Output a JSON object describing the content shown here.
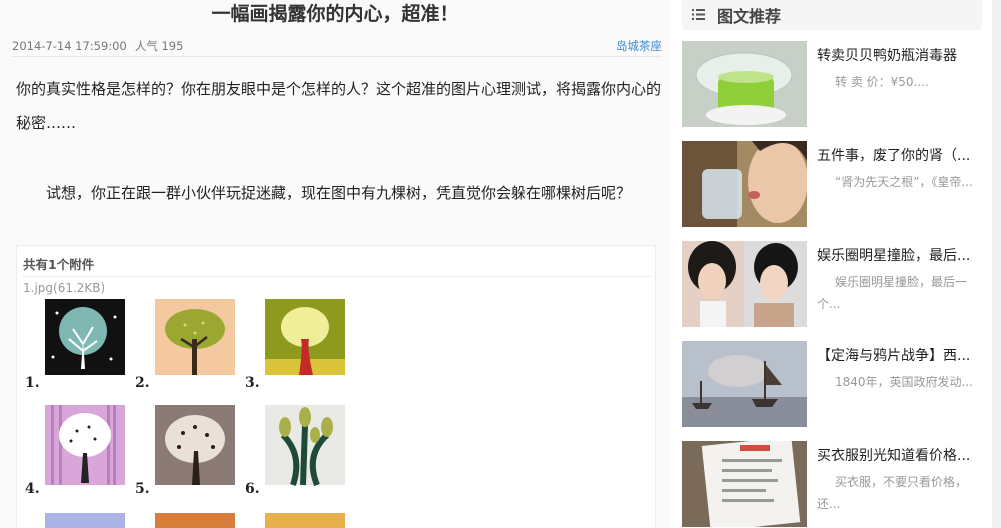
{
  "article": {
    "title": "一幅画揭露你的内心，超准！",
    "date": "2014-7-14 17:59:00",
    "views": "人气 195",
    "source": "岛城茶座",
    "paragraph1": "你的真实性格是怎样的？你在朋友眼中是个怎样的人？这个超准的图片心理测试，将揭露你内心的秘密……",
    "paragraph2": "试想，你正在跟一群小伙伴玩捉迷藏，现在图中有九棵树，凭直觉你会躲在哪棵树后呢？",
    "attachment": {
      "header": "共有1个附件",
      "file": "1.jpg(61.2KB)",
      "tiles": [
        {
          "num": "1.",
          "bg": "#111111"
        },
        {
          "num": "2.",
          "bg": "#f5c9a0"
        },
        {
          "num": "3.",
          "bg": "#8d9a1e"
        },
        {
          "num": "4.",
          "bg": "#d9a6d9"
        },
        {
          "num": "5.",
          "bg": "#8c7b74"
        },
        {
          "num": "6.",
          "bg": "#e9e9e6"
        }
      ]
    }
  },
  "sidebar": {
    "title": "图文推荐",
    "items": [
      {
        "title": "转卖贝贝鸭奶瓶消毒器",
        "desc": "转 卖 价：¥50....",
        "thumb": "sterilizer"
      },
      {
        "title": "五件事，废了你的肾（...",
        "desc": "“肾为先天之根”，《皇帝...",
        "thumb": "drink"
      },
      {
        "title": "娱乐圈明星撞脸，最后...",
        "desc": "娱乐圈明星撞脸，最后一个...",
        "thumb": "faces"
      },
      {
        "title": "【定海与鸦片战争】西...",
        "desc": "1840年，英国政府发动...",
        "thumb": "ships"
      },
      {
        "title": "买衣服别光知道看价格...",
        "desc": "买衣服，不要只看价格，还...",
        "thumb": "tag"
      }
    ]
  }
}
